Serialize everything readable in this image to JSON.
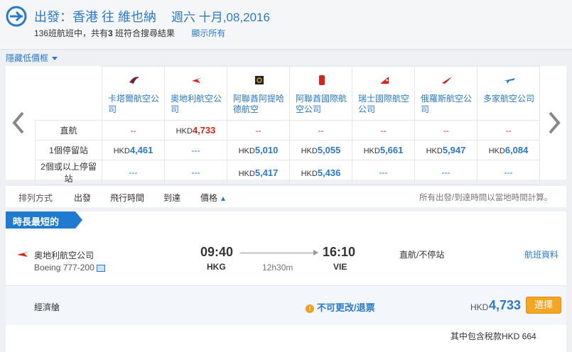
{
  "header": {
    "depart_label": "出發：",
    "origin": "香港",
    "to_word": "往",
    "destination": "維也納",
    "date": "週六  十月,08,2016",
    "summary_pre": "136班航班中，共有",
    "summary_count": "3",
    "summary_post": " 班符合搜尋結果",
    "show_all": "顯示所有"
  },
  "hide_low_price": "隱藏低價框",
  "matrix": {
    "airlines": [
      {
        "name": "卡塔爾航空公司",
        "icon": "qatar-airways-logo"
      },
      {
        "name": "奧地利航空公司",
        "icon": "austrian-airlines-logo"
      },
      {
        "name": "阿聯酋阿提哈德航空",
        "icon": "etihad-airways-logo"
      },
      {
        "name": "阿聯酋國際航空公司",
        "icon": "emirates-logo"
      },
      {
        "name": "瑞士國際航空公司",
        "icon": "swiss-logo"
      },
      {
        "name": "俄羅斯航空公司",
        "icon": "aeroflot-logo"
      },
      {
        "name": "多家航空公司",
        "icon": "multiple-airlines-logo"
      }
    ],
    "rows": [
      {
        "label": "直航",
        "cells": [
          {
            "type": "dash",
            "text": "--"
          },
          {
            "type": "price",
            "currency": "HKD",
            "amount": "4,733",
            "color": "red"
          },
          {
            "type": "dash",
            "text": "--"
          },
          {
            "type": "dash",
            "text": "--"
          },
          {
            "type": "dash",
            "text": "--"
          },
          {
            "type": "dash",
            "text": "--"
          },
          {
            "type": "dash",
            "text": "--"
          }
        ]
      },
      {
        "label": "1個停留站",
        "cells": [
          {
            "type": "price",
            "currency": "HKD",
            "amount": "4,461",
            "color": "blue"
          },
          {
            "type": "dash",
            "text": "---"
          },
          {
            "type": "price",
            "currency": "HKD",
            "amount": "5,010",
            "color": "blue"
          },
          {
            "type": "price",
            "currency": "HKD",
            "amount": "5,055",
            "color": "blue"
          },
          {
            "type": "price",
            "currency": "HKD",
            "amount": "5,661",
            "color": "blue"
          },
          {
            "type": "price",
            "currency": "HKD",
            "amount": "5,947",
            "color": "blue"
          },
          {
            "type": "price",
            "currency": "HKD",
            "amount": "6,084",
            "color": "blue"
          }
        ]
      },
      {
        "label": "2個或以上停留站",
        "cells": [
          {
            "type": "dash",
            "text": "---"
          },
          {
            "type": "dash",
            "text": "---"
          },
          {
            "type": "price",
            "currency": "HKD",
            "amount": "5,417",
            "color": "blue"
          },
          {
            "type": "price",
            "currency": "HKD",
            "amount": "5,436",
            "color": "blue"
          },
          {
            "type": "dash",
            "text": "---"
          },
          {
            "type": "dash",
            "text": "---"
          },
          {
            "type": "dash",
            "text": "---"
          }
        ]
      }
    ]
  },
  "sort": {
    "label": "排列方式",
    "options": [
      "出發",
      "飛行時間",
      "到達",
      "價格"
    ],
    "note": "所有出發/到達時間以當地時間計算。"
  },
  "result": {
    "tag": "時長最短的",
    "airline": "奧地利航空公司",
    "aircraft": "Boeing 777-200",
    "depart_time": "09:40",
    "arrive_time": "16:10",
    "depart_airport": "HKG",
    "arrive_airport": "VIE",
    "duration": "12h30m",
    "stops": "直航/不停站",
    "details_link": "航班資料",
    "fare_class": "經濟艙",
    "fare_rule": "不可更改/退票",
    "currency": "HKD",
    "price": "4,733",
    "select_label": "選擇",
    "tax_note": "其中包含稅款HKD 664"
  },
  "colors": {
    "accent": "#2a7ac9",
    "price_red": "#d9241b",
    "select": "#f5a623",
    "tag": "#1f7bd0"
  }
}
